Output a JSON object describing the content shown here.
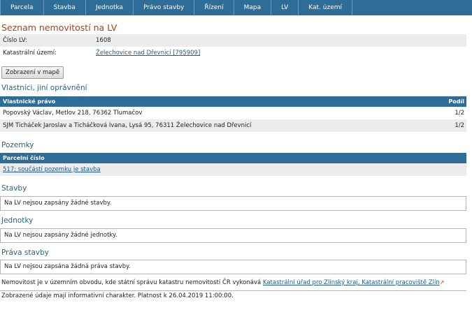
{
  "nav": {
    "tabs": [
      "Parcela",
      "Stavba",
      "Jednotka",
      "Právo stavby",
      "Řízení",
      "Mapa",
      "LV",
      "Kat. území"
    ]
  },
  "page_title": "Seznam nemovitostí na LV",
  "info": {
    "lv_label": "Číslo LV:",
    "lv_value": "1608",
    "ku_label": "Katastrální území:",
    "ku_value": "Želechovice nad Dřevnicí [795909]"
  },
  "map_button": "Zobrazení v mapě",
  "owners": {
    "title": "Vlastníci, jiní oprávnění",
    "col_left": "Vlastnické právo",
    "col_right": "Podíl",
    "rows": [
      {
        "name": "Popovský Václav, Metlov 218, 76362 Tlumačov",
        "share": "1/2"
      },
      {
        "name": "SJM Ticháček Jaroslav a Ticháčková Ivana, Lysá 95, 76311 Želechovice nad Dřevnicí",
        "share": "1/2"
      }
    ]
  },
  "parcels": {
    "title": "Pozemky",
    "col": "Parcelní číslo",
    "row_link": "517; součástí pozemku je stavba"
  },
  "buildings": {
    "title": "Stavby",
    "empty": "Na LV nejsou zapsány žádné stavby."
  },
  "units": {
    "title": "Jednotky",
    "empty": "Na LV nejsou zapsány žádné jednotky."
  },
  "rights": {
    "title": "Práva stavby",
    "empty": "Na LV nejsou zapsána žádná práva stavby."
  },
  "footer": {
    "text": "Nemovitost je v územním obvodu, kde státní správu katastru nemovitostí ČR vykonává",
    "link": "Katastrální úřad pro Zlínský kraj, Katastrální pracoviště Zlín",
    "link_icon": "external-link-icon",
    "note": "Zobrazené údaje mají informativní charakter. Platnost k 26.04.2019 11:00:00."
  },
  "colors": {
    "nav_bg": "#2d6d97",
    "title_red": "#b43c14",
    "section_blue": "#2a6288",
    "link_blue": "#1e5a8a",
    "row_alt": "#ececec"
  }
}
